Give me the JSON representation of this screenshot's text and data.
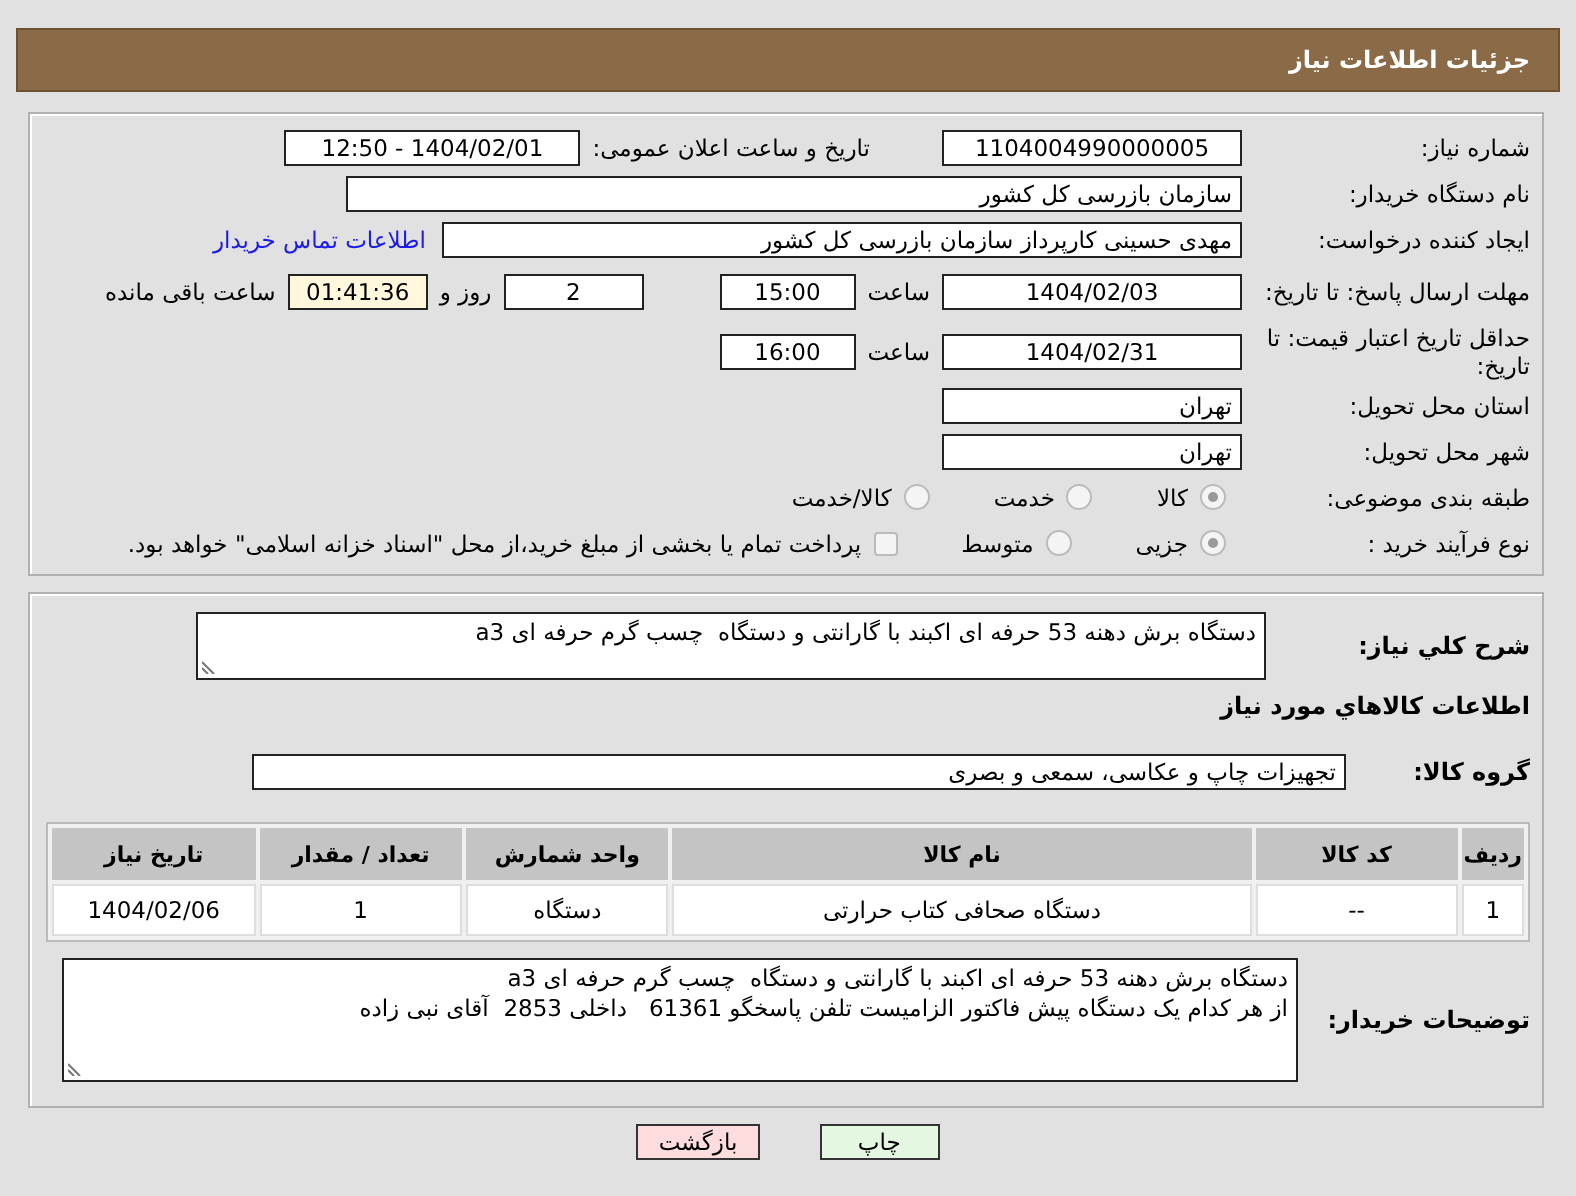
{
  "header": {
    "title": "جزئیات اطلاعات نیاز"
  },
  "details": {
    "need_number": {
      "label": "شماره نیاز:",
      "value": "1104004990000005"
    },
    "announce": {
      "label": "تاریخ و ساعت اعلان عمومی:",
      "value": "1404/02/01 - 12:50"
    },
    "buyer": {
      "label": "نام دستگاه خریدار:",
      "value": "سازمان بازرسی کل کشور"
    },
    "creator": {
      "label": "ایجاد کننده درخواست:",
      "value": "مهدی حسینی کارپرداز سازمان بازرسی کل کشور",
      "link": "اطلاعات تماس خریدار"
    },
    "deadline": {
      "label": "مهلت ارسال پاسخ: تا تاریخ:",
      "date": "1404/02/03",
      "time_label": "ساعت",
      "time": "15:00",
      "days": "2",
      "days_label": "روز و",
      "remaining": "01:41:36",
      "remaining_label": "ساعت باقی مانده"
    },
    "validity": {
      "label": "حداقل تاریخ اعتبار قیمت: تا تاریخ:",
      "date": "1404/02/31",
      "time_label": "ساعت",
      "time": "16:00"
    },
    "province": {
      "label": "استان محل تحویل:",
      "value": "تهران"
    },
    "city": {
      "label": "شهر محل تحویل:",
      "value": "تهران"
    },
    "category": {
      "label": "طبقه بندی موضوعی:",
      "options": [
        {
          "label": "کالا",
          "selected": true
        },
        {
          "label": "خدمت",
          "selected": false
        },
        {
          "label": "کالا/خدمت",
          "selected": false
        }
      ]
    },
    "process": {
      "label": "نوع فرآیند خرید :",
      "options": [
        {
          "label": "جزیی",
          "selected": true
        },
        {
          "label": "متوسط",
          "selected": false
        }
      ],
      "payment": {
        "label": "پرداخت تمام یا بخشی از مبلغ خرید،از محل \"اسناد خزانه اسلامی\" خواهد بود.",
        "checked": false
      }
    }
  },
  "goods": {
    "summary": {
      "label": "شرح کلي نياز:",
      "value": "دستگاه برش دهنه 53 حرفه ای اکبند با گارانتی و دستگاه  چسب گرم حرفه ای a3"
    },
    "heading": "اطلاعات کالاهاي مورد نياز",
    "group": {
      "label": "گروه کالا:",
      "value": "تجهیزات چاپ و عکاسی، سمعی و بصری"
    },
    "table": {
      "columns": [
        "ردیف",
        "کد کالا",
        "نام کالا",
        "واحد شمارش",
        "تعداد / مقدار",
        "تاریخ نیاز"
      ],
      "rows": [
        [
          "1",
          "--",
          "دستگاه صحافی کتاب حرارتی",
          "دستگاه",
          "1",
          "1404/02/06"
        ]
      ]
    },
    "notes": {
      "label": "توضیحات خریدار:",
      "value": "دستگاه برش دهنه 53 حرفه ای اکبند با گارانتی و دستگاه  چسب گرم حرفه ای a3\nاز هر کدام یک دستگاه پیش فاکتور الزامیست تلفن پاسخگو 61361   داخلی 2853  آقای نبی زاده"
    }
  },
  "buttons": [
    {
      "label": "چاپ",
      "kind": "print"
    },
    {
      "label": "بازگشت",
      "kind": "back"
    }
  ]
}
